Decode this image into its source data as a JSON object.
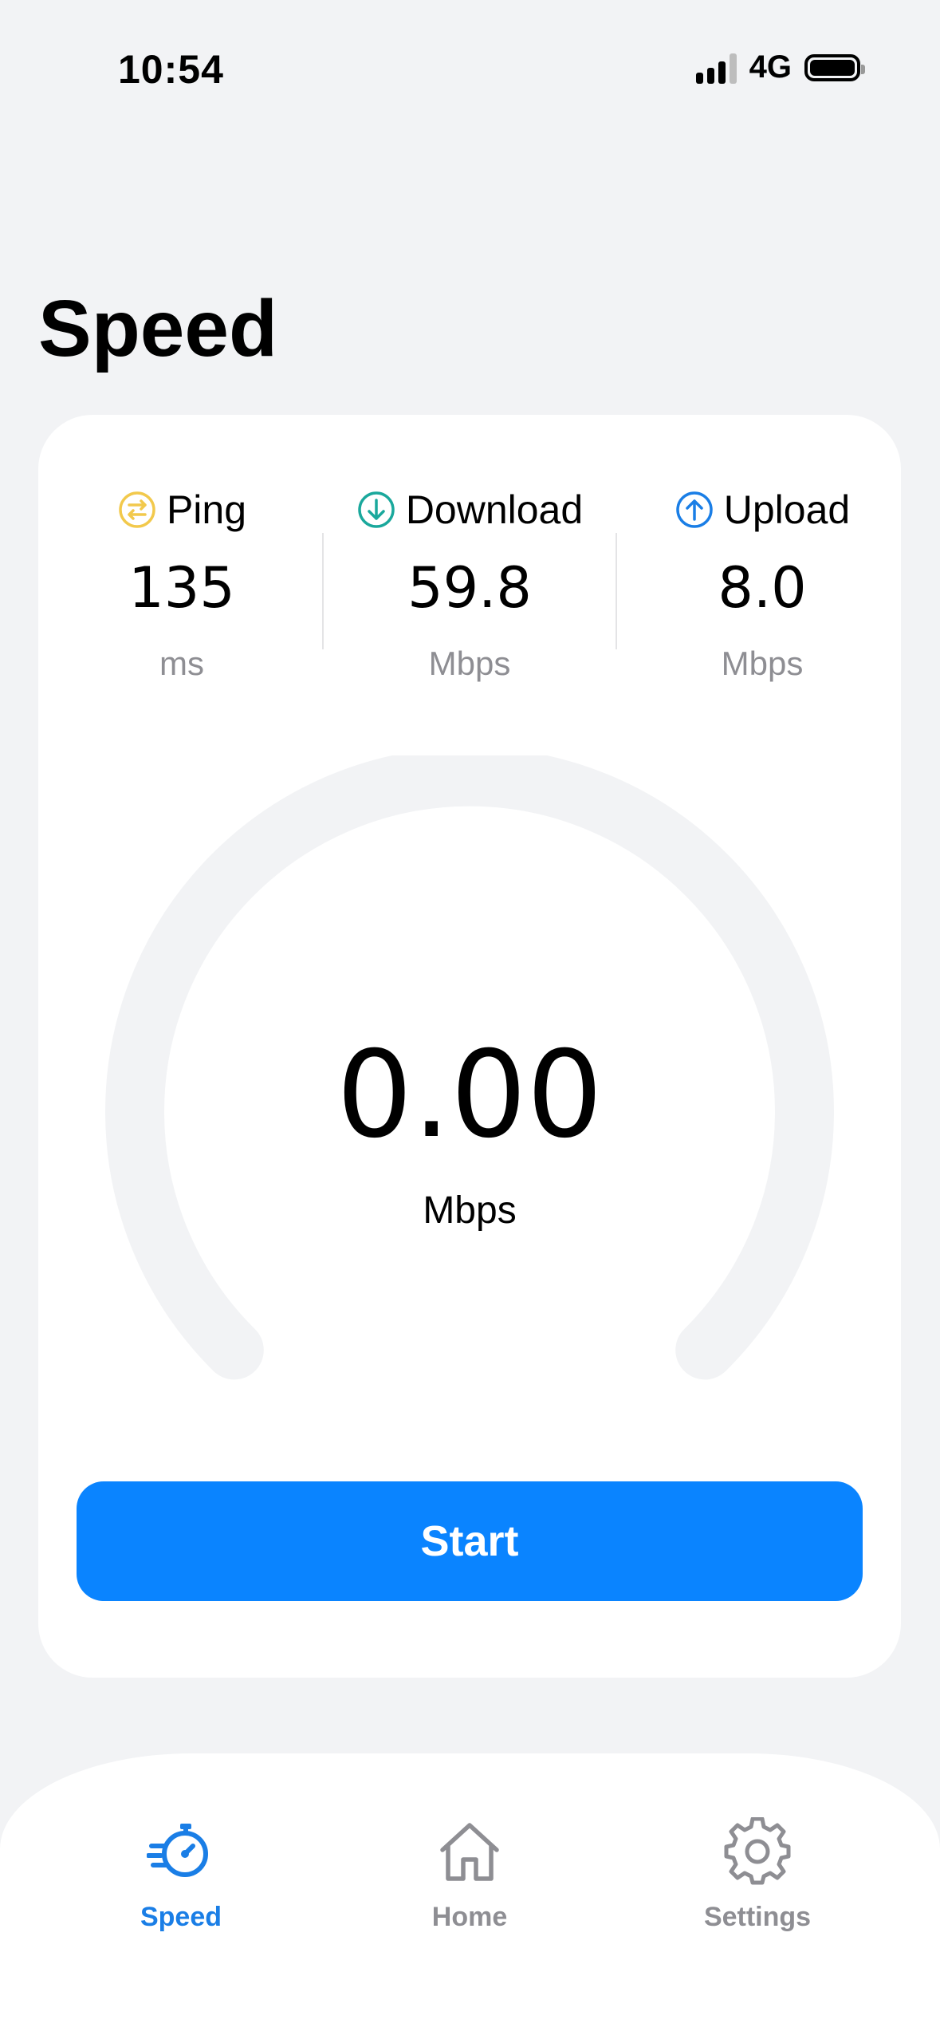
{
  "status_bar": {
    "time": "10:54",
    "network": "4G"
  },
  "page_title": "Speed",
  "stats": {
    "ping": {
      "label": "Ping",
      "value": "135",
      "unit": "ms",
      "icon": "ping-icon",
      "color": "#f2c94c"
    },
    "download": {
      "label": "Download",
      "value": "59.8",
      "unit": "Mbps",
      "icon": "download-arrow-icon",
      "color": "#1aa89c"
    },
    "upload": {
      "label": "Upload",
      "value": "8.0",
      "unit": "Mbps",
      "icon": "upload-arrow-icon",
      "color": "#1a7ee6"
    }
  },
  "gauge": {
    "value": "0.00",
    "unit": "Mbps",
    "level": 0
  },
  "start_button": "Start",
  "tabs": [
    {
      "label": "Speed",
      "icon": "stopwatch-speed-icon",
      "active": true
    },
    {
      "label": "Home",
      "icon": "home-icon",
      "active": false
    },
    {
      "label": "Settings",
      "icon": "gear-icon",
      "active": false
    }
  ],
  "colors": {
    "accent": "#0a84ff",
    "tab_active": "#1a7ee6",
    "tab_inactive": "#8e8e93",
    "background": "#f2f3f5"
  }
}
